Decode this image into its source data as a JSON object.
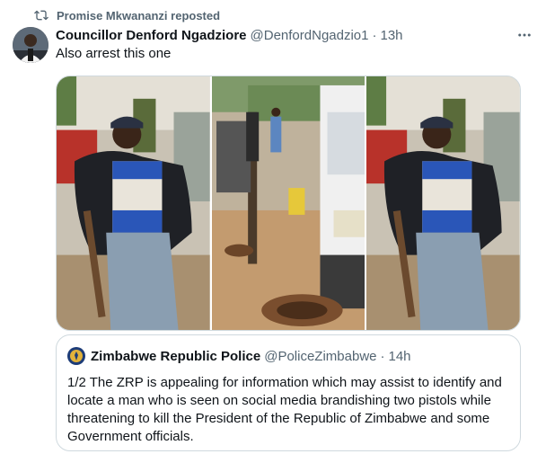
{
  "repost": {
    "label": "Promise Mkwananzi reposted",
    "icon": "repost-icon"
  },
  "tweet": {
    "author_name": "Councillor Denford Ngadziore",
    "author_handle": "@DenfordNgadzio1",
    "separator": "·",
    "time": "13h",
    "text": "Also arrest this one",
    "more_icon": "more-horizontal-icon"
  },
  "media": [
    {
      "name": "photo-man-with-rifle-left",
      "icon": "image"
    },
    {
      "name": "photo-yard-scene-middle",
      "icon": "image"
    },
    {
      "name": "photo-man-with-rifle-right",
      "icon": "image"
    }
  ],
  "quote": {
    "author_name": "Zimbabwe Republic Police",
    "author_handle": "@PoliceZimbabwe",
    "separator": "·",
    "time": "14h",
    "text": "1/2 The ZRP is appealing for information which may assist to identify and locate a man who is seen on social media brandishing two pistols while threatening to kill the President of the Republic of Zimbabwe and some Government officials."
  },
  "colors": {
    "text": "#0f1419",
    "secondary": "#536471",
    "border": "#cfd9de",
    "background": "#ffffff"
  }
}
